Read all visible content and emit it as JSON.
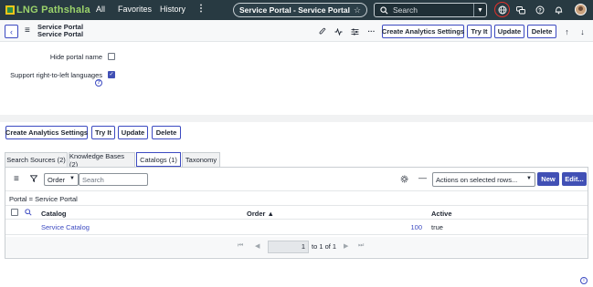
{
  "banner": {
    "brand": "LNG Pathshala",
    "nav": {
      "all": "All",
      "favorites": "Favorites",
      "history": "History",
      "more": "⋮"
    },
    "portal_pill": "Service Portal - Service Portal",
    "search_placeholder": "Search"
  },
  "header": {
    "title_line1": "Service Portal",
    "title_line2": "Service Portal",
    "buttons": {
      "create_analytics": "Create Analytics Settings",
      "try_it": "Try It",
      "update": "Update",
      "delete": "Delete"
    }
  },
  "form": {
    "hide_portal_name_label": "Hide portal name",
    "hide_portal_name_checked": false,
    "rtl_label": "Support right-to-left languages",
    "rtl_checked": true
  },
  "bottom_buttons": {
    "create_analytics": "Create Analytics Settings",
    "try_it": "Try It",
    "update": "Update",
    "delete": "Delete"
  },
  "tabs": [
    {
      "label": "Search Sources (2)",
      "active": false
    },
    {
      "label": "Knowledge Bases (2)",
      "active": false
    },
    {
      "label": "Catalogs (1)",
      "active": true
    },
    {
      "label": "Taxonomy",
      "active": false
    }
  ],
  "list": {
    "field_select": "Order",
    "search_placeholder": "Search",
    "actions_select": "Actions on selected rows...",
    "new_button": "New",
    "edit_button": "Edit...",
    "breadcrumb": "Portal = Service Portal",
    "columns": {
      "catalog": "Catalog",
      "order": "Order ▲",
      "active": "Active"
    },
    "rows": [
      {
        "catalog": "Service Catalog",
        "order": "100",
        "active": "true"
      }
    ],
    "pager": {
      "current": "1",
      "range_text": "to 1 of 1"
    }
  }
}
